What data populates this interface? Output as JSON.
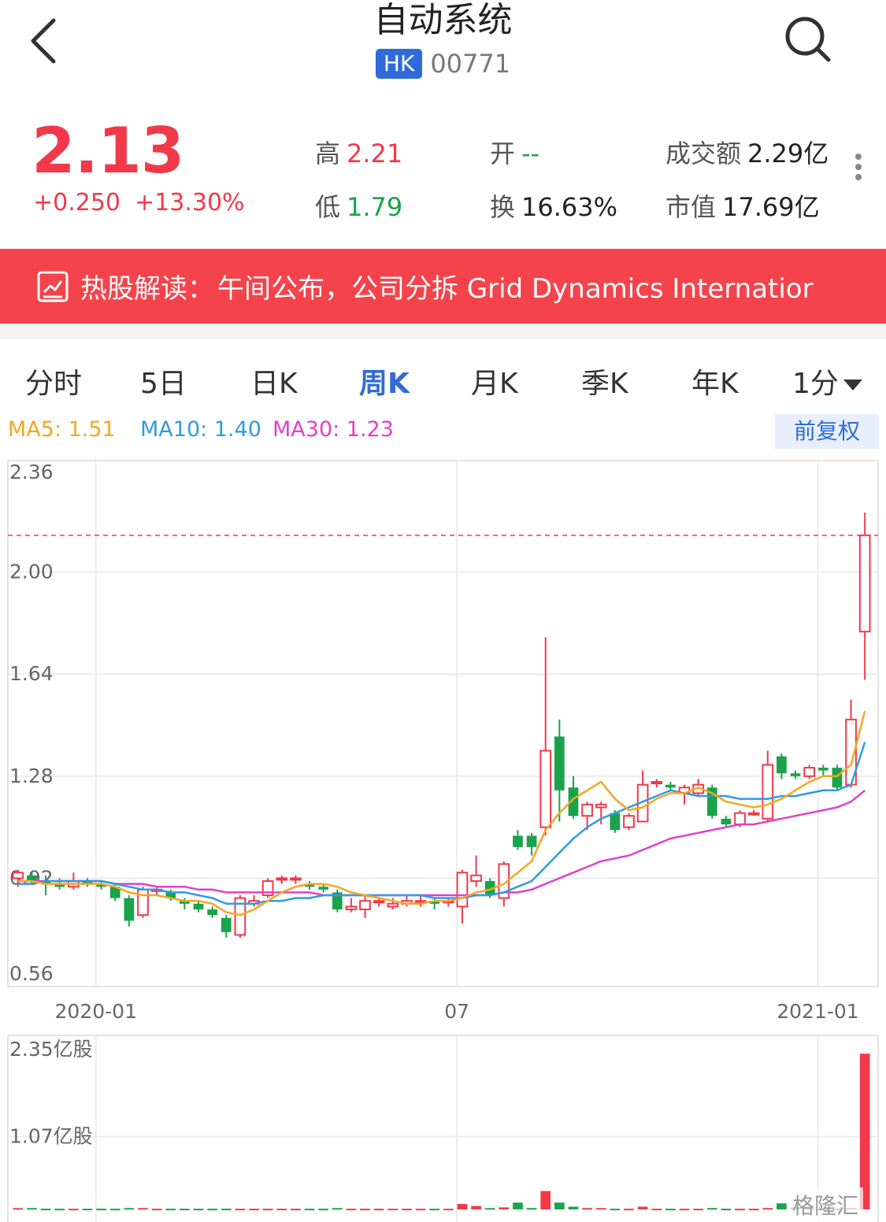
{
  "header": {
    "title": "自动系统",
    "market": "HK",
    "code": "00771"
  },
  "quote": {
    "price": "2.13",
    "change": "+0.250",
    "change_pct": "+13.30%",
    "high_label": "高",
    "high": "2.21",
    "low_label": "低",
    "low": "1.79",
    "open_label": "开",
    "open": "--",
    "turnover_label": "换",
    "turnover": "16.63%",
    "amount_label": "成交额",
    "amount": "2.29亿",
    "mktcap_label": "市值",
    "mktcap": "17.69亿"
  },
  "banner": {
    "label": "热股解读：",
    "text": "午间公布，公司分拆 Grid Dynamics Internatior"
  },
  "tabs": [
    "分时",
    "5日",
    "日K",
    "周K",
    "月K",
    "季K",
    "年K",
    "1分"
  ],
  "active_tab": "周K",
  "ma": {
    "ma5": "MA5: 1.51",
    "ma10": "MA10: 1.40",
    "ma30": "MA30: 1.23"
  },
  "adjust_button": "前复权",
  "watermark": "格隆汇",
  "colors": {
    "up": "#f2394a",
    "down": "#1aa34a",
    "ma5": "#f5a623",
    "ma10": "#2f9be0",
    "ma30": "#e040c8",
    "accent": "#2f6bd9"
  },
  "chart_data": {
    "type": "candlestick",
    "price_axis": {
      "min": 0.56,
      "max": 2.36,
      "ticks": [
        "2.36",
        "2.00",
        "1.64",
        "1.28",
        "0.92",
        "0.56"
      ]
    },
    "volume_axis": {
      "max": 2.35,
      "ticks": [
        "2.35亿股",
        "1.07亿股"
      ]
    },
    "x_labels": [
      "2020-01",
      "07",
      "2021-01"
    ],
    "last_price_line": 2.13,
    "candles": [
      [
        0.92,
        0.94,
        0.95,
        0.89
      ],
      [
        0.93,
        0.91,
        0.94,
        0.9
      ],
      [
        0.91,
        0.9,
        0.93,
        0.86
      ],
      [
        0.9,
        0.89,
        0.92,
        0.88
      ],
      [
        0.89,
        0.91,
        0.94,
        0.88
      ],
      [
        0.91,
        0.9,
        0.92,
        0.89
      ],
      [
        0.9,
        0.89,
        0.91,
        0.88
      ],
      [
        0.89,
        0.85,
        0.9,
        0.84
      ],
      [
        0.85,
        0.77,
        0.86,
        0.75
      ],
      [
        0.79,
        0.88,
        0.89,
        0.78
      ],
      [
        0.88,
        0.88,
        0.89,
        0.86
      ],
      [
        0.87,
        0.85,
        0.88,
        0.84
      ],
      [
        0.84,
        0.83,
        0.85,
        0.81
      ],
      [
        0.83,
        0.81,
        0.84,
        0.8
      ],
      [
        0.81,
        0.79,
        0.82,
        0.78
      ],
      [
        0.78,
        0.73,
        0.79,
        0.71
      ],
      [
        0.72,
        0.85,
        0.86,
        0.71
      ],
      [
        0.83,
        0.84,
        0.86,
        0.82
      ],
      [
        0.86,
        0.91,
        0.92,
        0.85
      ],
      [
        0.92,
        0.92,
        0.93,
        0.9
      ],
      [
        0.92,
        0.92,
        0.93,
        0.9
      ],
      [
        0.9,
        0.89,
        0.91,
        0.88
      ],
      [
        0.89,
        0.88,
        0.9,
        0.87
      ],
      [
        0.87,
        0.81,
        0.88,
        0.8
      ],
      [
        0.81,
        0.82,
        0.85,
        0.8
      ],
      [
        0.81,
        0.84,
        0.86,
        0.78
      ],
      [
        0.84,
        0.84,
        0.85,
        0.82
      ],
      [
        0.82,
        0.83,
        0.85,
        0.81
      ],
      [
        0.83,
        0.84,
        0.86,
        0.82
      ],
      [
        0.84,
        0.84,
        0.86,
        0.82
      ],
      [
        0.84,
        0.83,
        0.85,
        0.81
      ],
      [
        0.84,
        0.84,
        0.85,
        0.82
      ],
      [
        0.82,
        0.94,
        0.95,
        0.76
      ],
      [
        0.91,
        0.93,
        1.0,
        0.89
      ],
      [
        0.91,
        0.86,
        0.92,
        0.85
      ],
      [
        0.85,
        0.97,
        0.98,
        0.82
      ],
      [
        1.07,
        1.03,
        1.09,
        1.02
      ],
      [
        1.07,
        1.03,
        1.08,
        1.0
      ],
      [
        1.1,
        1.37,
        1.77,
        1.07
      ],
      [
        1.42,
        1.23,
        1.48,
        1.12
      ],
      [
        1.24,
        1.14,
        1.28,
        1.13
      ],
      [
        1.14,
        1.18,
        1.19,
        1.09
      ],
      [
        1.17,
        1.18,
        1.19,
        1.11
      ],
      [
        1.15,
        1.09,
        1.16,
        1.08
      ],
      [
        1.1,
        1.14,
        1.15,
        1.09
      ],
      [
        1.12,
        1.25,
        1.3,
        1.12
      ],
      [
        1.26,
        1.26,
        1.27,
        1.24
      ],
      [
        1.25,
        1.24,
        1.26,
        1.23
      ],
      [
        1.22,
        1.24,
        1.25,
        1.18
      ],
      [
        1.22,
        1.25,
        1.27,
        1.21
      ],
      [
        1.24,
        1.14,
        1.25,
        1.13
      ],
      [
        1.13,
        1.11,
        1.14,
        1.1
      ],
      [
        1.11,
        1.15,
        1.16,
        1.1
      ],
      [
        1.15,
        1.15,
        1.16,
        1.14
      ],
      [
        1.13,
        1.32,
        1.37,
        1.12
      ],
      [
        1.35,
        1.29,
        1.36,
        1.27
      ],
      [
        1.29,
        1.28,
        1.3,
        1.27
      ],
      [
        1.28,
        1.31,
        1.32,
        1.27
      ],
      [
        1.31,
        1.3,
        1.32,
        1.28
      ],
      [
        1.31,
        1.24,
        1.32,
        1.23
      ],
      [
        1.25,
        1.48,
        1.55,
        1.24
      ],
      [
        1.79,
        2.13,
        2.21,
        1.62
      ]
    ],
    "ma5": [
      0.91,
      0.91,
      0.9,
      0.9,
      0.9,
      0.9,
      0.9,
      0.89,
      0.87,
      0.86,
      0.86,
      0.85,
      0.84,
      0.84,
      0.83,
      0.8,
      0.79,
      0.81,
      0.84,
      0.87,
      0.89,
      0.9,
      0.9,
      0.89,
      0.87,
      0.86,
      0.85,
      0.84,
      0.83,
      0.83,
      0.84,
      0.84,
      0.85,
      0.87,
      0.88,
      0.9,
      0.94,
      0.98,
      1.09,
      1.15,
      1.2,
      1.23,
      1.26,
      1.2,
      1.16,
      1.17,
      1.2,
      1.22,
      1.22,
      1.24,
      1.22,
      1.19,
      1.18,
      1.17,
      1.18,
      1.2,
      1.23,
      1.26,
      1.28,
      1.28,
      1.32,
      1.51
    ],
    "ma10": [
      0.9,
      0.9,
      0.91,
      0.91,
      0.91,
      0.91,
      0.91,
      0.9,
      0.89,
      0.88,
      0.88,
      0.87,
      0.87,
      0.86,
      0.85,
      0.83,
      0.83,
      0.83,
      0.84,
      0.84,
      0.85,
      0.85,
      0.86,
      0.86,
      0.86,
      0.86,
      0.86,
      0.86,
      0.86,
      0.86,
      0.85,
      0.85,
      0.85,
      0.86,
      0.86,
      0.87,
      0.89,
      0.91,
      0.96,
      1.01,
      1.06,
      1.1,
      1.13,
      1.15,
      1.17,
      1.19,
      1.21,
      1.23,
      1.22,
      1.21,
      1.21,
      1.21,
      1.2,
      1.2,
      1.2,
      1.21,
      1.21,
      1.22,
      1.23,
      1.23,
      1.25,
      1.4
    ],
    "ma30": [
      0.91,
      0.91,
      0.91,
      0.91,
      0.91,
      0.91,
      0.91,
      0.9,
      0.9,
      0.9,
      0.89,
      0.89,
      0.89,
      0.88,
      0.88,
      0.87,
      0.87,
      0.87,
      0.87,
      0.87,
      0.87,
      0.87,
      0.86,
      0.86,
      0.86,
      0.86,
      0.86,
      0.86,
      0.86,
      0.86,
      0.86,
      0.86,
      0.86,
      0.86,
      0.86,
      0.87,
      0.87,
      0.88,
      0.9,
      0.92,
      0.94,
      0.96,
      0.98,
      0.99,
      1.0,
      1.02,
      1.04,
      1.06,
      1.07,
      1.08,
      1.09,
      1.1,
      1.11,
      1.11,
      1.12,
      1.13,
      1.14,
      1.15,
      1.16,
      1.17,
      1.19,
      1.23
    ],
    "volumes": [
      0.02,
      0.02,
      0.01,
      0.01,
      0.01,
      0.01,
      0.01,
      0.01,
      0.02,
      0.02,
      0.01,
      0.01,
      0.01,
      0.01,
      0.01,
      0.01,
      0.01,
      0.01,
      0.01,
      0.01,
      0.01,
      0.01,
      0.01,
      0.02,
      0.01,
      0.01,
      0.01,
      0.01,
      0.01,
      0.01,
      0.01,
      0.01,
      0.08,
      0.05,
      0.02,
      0.03,
      0.1,
      0.02,
      0.27,
      0.1,
      0.04,
      0.02,
      0.02,
      0.01,
      0.01,
      0.04,
      0.01,
      0.01,
      0.01,
      0.01,
      0.02,
      0.01,
      0.01,
      0.01,
      0.02,
      0.09,
      0.03,
      0.02,
      0.01,
      0.01,
      0.02,
      2.29
    ]
  }
}
